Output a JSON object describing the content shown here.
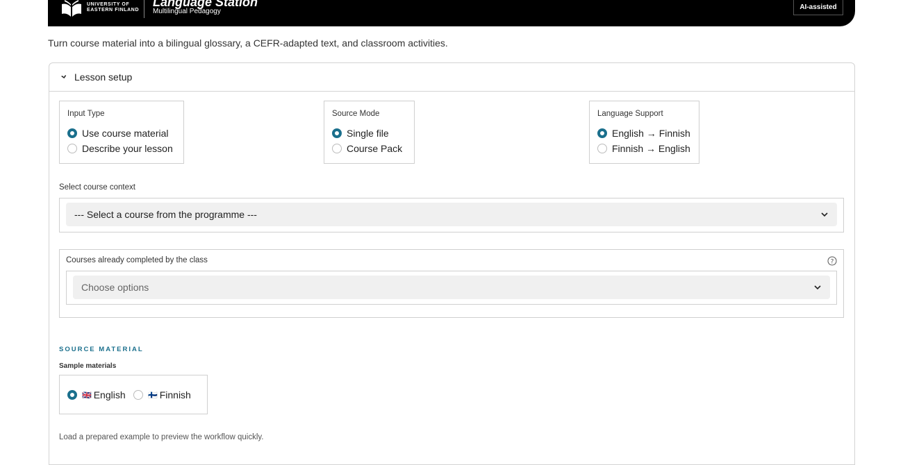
{
  "header": {
    "university_line1": "UNIVERSITY OF",
    "university_line2": "EASTERN FINLAND",
    "title": "Language Station",
    "subtitle": "Multilingual Pedagogy",
    "badge": "AI-assisted",
    "background": "#000000"
  },
  "intro": "Turn course material into a bilingual glossary, a CEFR-adapted text, and classroom activities.",
  "lesson_setup": {
    "title": "Lesson setup",
    "input_type": {
      "label": "Input Type",
      "options": [
        "Use course material",
        "Describe your lesson"
      ],
      "selected": 0
    },
    "source_mode": {
      "label": "Source Mode",
      "options": [
        "Single file",
        "Course Pack"
      ],
      "selected": 0
    },
    "language_support": {
      "label": "Language Support",
      "options": [
        "English → Finnish",
        "Finnish → English"
      ],
      "selected": 0
    },
    "course_context": {
      "label": "Select course context",
      "value": "--- Select a course from the programme ---"
    },
    "completed_courses": {
      "label": "Courses already completed by the class",
      "placeholder": "Choose options"
    },
    "source_material": {
      "kicker": "SOURCE MATERIAL",
      "sample_label": "Sample materials",
      "options": [
        {
          "flag": "🇬🇧",
          "label": "English"
        },
        {
          "flag": "🇫🇮",
          "label": "Finnish"
        }
      ],
      "selected": 0
    },
    "note": "Load a prepared example to preview the workflow quickly."
  },
  "colors": {
    "accent": "#1a6f8c",
    "border": "#cfcfcf",
    "select_bg": "#f0f0f0"
  }
}
